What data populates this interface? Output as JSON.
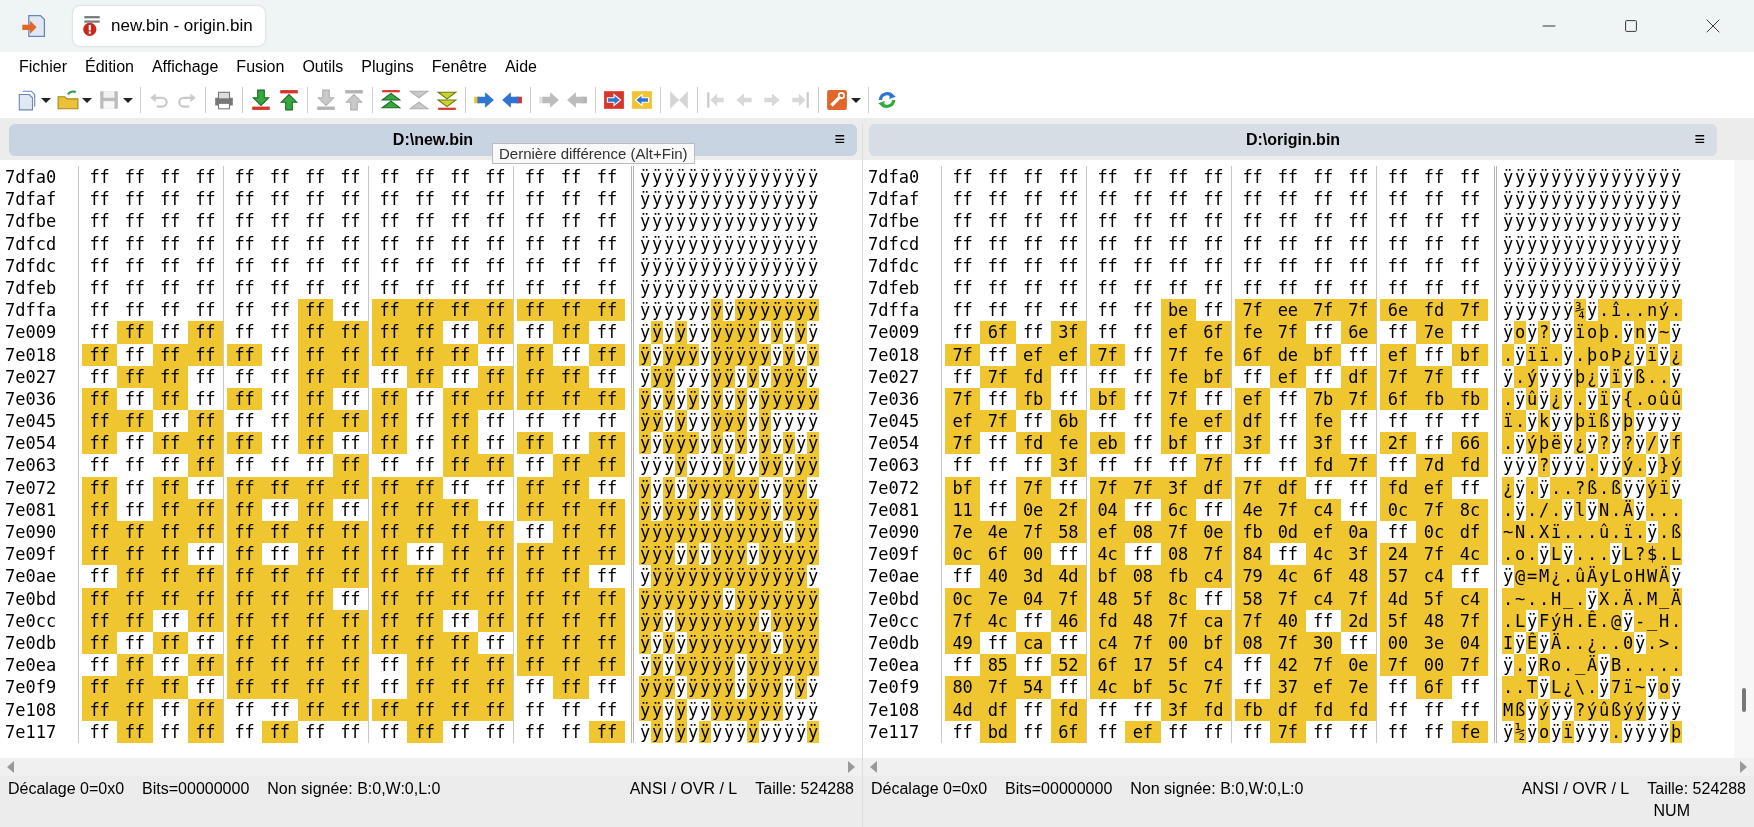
{
  "window": {
    "title": "new.bin - origin.bin"
  },
  "menu": [
    "Fichier",
    "Édition",
    "Affichage",
    "Fusion",
    "Outils",
    "Plugins",
    "Fenêtre",
    "Aide"
  ],
  "toolbar": [
    [
      {
        "disabled": false,
        "dropdown": true
      },
      {
        "disabled": false,
        "dropdown": true
      },
      {
        "disabled": true,
        "dropdown": true
      }
    ],
    [
      {
        "disabled": true,
        "dropdown": false
      },
      {
        "disabled": true,
        "dropdown": false
      }
    ],
    [
      {
        "disabled": false,
        "dropdown": false
      }
    ],
    [
      {
        "disabled": false,
        "dropdown": false
      },
      {
        "disabled": false,
        "dropdown": false
      }
    ],
    [
      {
        "disabled": true,
        "dropdown": false
      },
      {
        "disabled": true,
        "dropdown": false
      }
    ],
    [
      {
        "disabled": false,
        "dropdown": false
      },
      {
        "disabled": true,
        "dropdown": false
      },
      {
        "disabled": false,
        "dropdown": false
      }
    ],
    [
      {
        "disabled": false,
        "dropdown": false
      },
      {
        "disabled": false,
        "dropdown": false
      }
    ],
    [
      {
        "disabled": true,
        "dropdown": false
      },
      {
        "disabled": true,
        "dropdown": false
      }
    ],
    [
      {
        "disabled": false,
        "dropdown": false
      },
      {
        "disabled": false,
        "dropdown": false
      }
    ],
    [
      {
        "disabled": true,
        "dropdown": false
      }
    ],
    [
      {
        "disabled": true,
        "dropdown": false
      },
      {
        "disabled": true,
        "dropdown": false
      },
      {
        "disabled": true,
        "dropdown": false
      },
      {
        "disabled": true,
        "dropdown": false
      }
    ],
    [
      {
        "disabled": false,
        "dropdown": true
      }
    ],
    [
      {
        "disabled": false,
        "dropdown": false
      }
    ]
  ],
  "tooltip": "Dernière différence (Alt+Fin)",
  "panes": [
    {
      "title": "D:\\new.bin",
      "menu_glyph": "≡",
      "active": true,
      "rows": [
        {
          "offset": "7dfa0",
          "bytes": [
            "ff",
            "ff",
            "ff",
            "ff",
            "ff",
            "ff",
            "ff",
            "ff",
            "ff",
            "ff",
            "ff",
            "ff",
            "ff",
            "ff",
            "ff"
          ],
          "ascii": "ÿÿÿÿÿÿÿÿÿÿÿÿÿÿÿ"
        },
        {
          "offset": "7dfaf",
          "bytes": [
            "ff",
            "ff",
            "ff",
            "ff",
            "ff",
            "ff",
            "ff",
            "ff",
            "ff",
            "ff",
            "ff",
            "ff",
            "ff",
            "ff",
            "ff"
          ],
          "ascii": "ÿÿÿÿÿÿÿÿÿÿÿÿÿÿÿ"
        },
        {
          "offset": "7dfbe",
          "bytes": [
            "ff",
            "ff",
            "ff",
            "ff",
            "ff",
            "ff",
            "ff",
            "ff",
            "ff",
            "ff",
            "ff",
            "ff",
            "ff",
            "ff",
            "ff"
          ],
          "ascii": "ÿÿÿÿÿÿÿÿÿÿÿÿÿÿÿ"
        },
        {
          "offset": "7dfcd",
          "bytes": [
            "ff",
            "ff",
            "ff",
            "ff",
            "ff",
            "ff",
            "ff",
            "ff",
            "ff",
            "ff",
            "ff",
            "ff",
            "ff",
            "ff",
            "ff"
          ],
          "ascii": "ÿÿÿÿÿÿÿÿÿÿÿÿÿÿÿ"
        },
        {
          "offset": "7dfdc",
          "bytes": [
            "ff",
            "ff",
            "ff",
            "ff",
            "ff",
            "ff",
            "ff",
            "ff",
            "ff",
            "ff",
            "ff",
            "ff",
            "ff",
            "ff",
            "ff"
          ],
          "ascii": "ÿÿÿÿÿÿÿÿÿÿÿÿÿÿÿ"
        },
        {
          "offset": "7dfeb",
          "bytes": [
            "ff",
            "ff",
            "ff",
            "ff",
            "ff",
            "ff",
            "ff",
            "ff",
            "ff",
            "ff",
            "ff",
            "ff",
            "ff",
            "ff",
            "ff"
          ],
          "ascii": "ÿÿÿÿÿÿÿÿÿÿÿÿÿÿÿ"
        },
        {
          "offset": "7dffa",
          "bytes": [
            "ff",
            "ff",
            "ff",
            "ff",
            "ff",
            "ff",
            "ff",
            "ff",
            "ff",
            "ff",
            "ff",
            "ff",
            "ff",
            "ff",
            "ff"
          ],
          "ascii": "ÿÿÿÿÿÿÿÿÿÿÿÿÿÿÿ"
        },
        {
          "offset": "7e009",
          "bytes": [
            "ff",
            "ff",
            "ff",
            "ff",
            "ff",
            "ff",
            "ff",
            "ff",
            "ff",
            "ff",
            "ff",
            "ff",
            "ff",
            "ff",
            "ff"
          ],
          "ascii": "ÿÿÿÿÿÿÿÿÿÿÿÿÿÿÿ"
        },
        {
          "offset": "7e018",
          "bytes": [
            "ff",
            "ff",
            "ff",
            "ff",
            "ff",
            "ff",
            "ff",
            "ff",
            "ff",
            "ff",
            "ff",
            "ff",
            "ff",
            "ff",
            "ff"
          ],
          "ascii": "ÿÿÿÿÿÿÿÿÿÿÿÿÿÿÿ"
        },
        {
          "offset": "7e027",
          "bytes": [
            "ff",
            "ff",
            "ff",
            "ff",
            "ff",
            "ff",
            "ff",
            "ff",
            "ff",
            "ff",
            "ff",
            "ff",
            "ff",
            "ff",
            "ff"
          ],
          "ascii": "ÿÿÿÿÿÿÿÿÿÿÿÿÿÿÿ"
        },
        {
          "offset": "7e036",
          "bytes": [
            "ff",
            "ff",
            "ff",
            "ff",
            "ff",
            "ff",
            "ff",
            "ff",
            "ff",
            "ff",
            "ff",
            "ff",
            "ff",
            "ff",
            "ff"
          ],
          "ascii": "ÿÿÿÿÿÿÿÿÿÿÿÿÿÿÿ"
        },
        {
          "offset": "7e045",
          "bytes": [
            "ff",
            "ff",
            "ff",
            "ff",
            "ff",
            "ff",
            "ff",
            "ff",
            "ff",
            "ff",
            "ff",
            "ff",
            "ff",
            "ff",
            "ff"
          ],
          "ascii": "ÿÿÿÿÿÿÿÿÿÿÿÿÿÿÿ"
        },
        {
          "offset": "7e054",
          "bytes": [
            "ff",
            "ff",
            "ff",
            "ff",
            "ff",
            "ff",
            "ff",
            "ff",
            "ff",
            "ff",
            "ff",
            "ff",
            "ff",
            "ff",
            "ff"
          ],
          "ascii": "ÿÿÿÿÿÿÿÿÿÿÿÿÿÿÿ"
        },
        {
          "offset": "7e063",
          "bytes": [
            "ff",
            "ff",
            "ff",
            "ff",
            "ff",
            "ff",
            "ff",
            "ff",
            "ff",
            "ff",
            "ff",
            "ff",
            "ff",
            "ff",
            "ff"
          ],
          "ascii": "ÿÿÿÿÿÿÿÿÿÿÿÿÿÿÿ"
        },
        {
          "offset": "7e072",
          "bytes": [
            "ff",
            "ff",
            "ff",
            "ff",
            "ff",
            "ff",
            "ff",
            "ff",
            "ff",
            "ff",
            "ff",
            "ff",
            "ff",
            "ff",
            "ff"
          ],
          "ascii": "ÿÿÿÿÿÿÿÿÿÿÿÿÿÿÿ"
        },
        {
          "offset": "7e081",
          "bytes": [
            "ff",
            "ff",
            "ff",
            "ff",
            "ff",
            "ff",
            "ff",
            "ff",
            "ff",
            "ff",
            "ff",
            "ff",
            "ff",
            "ff",
            "ff"
          ],
          "ascii": "ÿÿÿÿÿÿÿÿÿÿÿÿÿÿÿ"
        },
        {
          "offset": "7e090",
          "bytes": [
            "ff",
            "ff",
            "ff",
            "ff",
            "ff",
            "ff",
            "ff",
            "ff",
            "ff",
            "ff",
            "ff",
            "ff",
            "ff",
            "ff",
            "ff"
          ],
          "ascii": "ÿÿÿÿÿÿÿÿÿÿÿÿÿÿÿ"
        },
        {
          "offset": "7e09f",
          "bytes": [
            "ff",
            "ff",
            "ff",
            "ff",
            "ff",
            "ff",
            "ff",
            "ff",
            "ff",
            "ff",
            "ff",
            "ff",
            "ff",
            "ff",
            "ff"
          ],
          "ascii": "ÿÿÿÿÿÿÿÿÿÿÿÿÿÿÿ"
        },
        {
          "offset": "7e0ae",
          "bytes": [
            "ff",
            "ff",
            "ff",
            "ff",
            "ff",
            "ff",
            "ff",
            "ff",
            "ff",
            "ff",
            "ff",
            "ff",
            "ff",
            "ff",
            "ff"
          ],
          "ascii": "ÿÿÿÿÿÿÿÿÿÿÿÿÿÿÿ"
        },
        {
          "offset": "7e0bd",
          "bytes": [
            "ff",
            "ff",
            "ff",
            "ff",
            "ff",
            "ff",
            "ff",
            "ff",
            "ff",
            "ff",
            "ff",
            "ff",
            "ff",
            "ff",
            "ff"
          ],
          "ascii": "ÿÿÿÿÿÿÿÿÿÿÿÿÿÿÿ"
        },
        {
          "offset": "7e0cc",
          "bytes": [
            "ff",
            "ff",
            "ff",
            "ff",
            "ff",
            "ff",
            "ff",
            "ff",
            "ff",
            "ff",
            "ff",
            "ff",
            "ff",
            "ff",
            "ff"
          ],
          "ascii": "ÿÿÿÿÿÿÿÿÿÿÿÿÿÿÿ"
        },
        {
          "offset": "7e0db",
          "bytes": [
            "ff",
            "ff",
            "ff",
            "ff",
            "ff",
            "ff",
            "ff",
            "ff",
            "ff",
            "ff",
            "ff",
            "ff",
            "ff",
            "ff",
            "ff"
          ],
          "ascii": "ÿÿÿÿÿÿÿÿÿÿÿÿÿÿÿ"
        },
        {
          "offset": "7e0ea",
          "bytes": [
            "ff",
            "ff",
            "ff",
            "ff",
            "ff",
            "ff",
            "ff",
            "ff",
            "ff",
            "ff",
            "ff",
            "ff",
            "ff",
            "ff",
            "ff"
          ],
          "ascii": "ÿÿÿÿÿÿÿÿÿÿÿÿÿÿÿ"
        },
        {
          "offset": "7e0f9",
          "bytes": [
            "ff",
            "ff",
            "ff",
            "ff",
            "ff",
            "ff",
            "ff",
            "ff",
            "ff",
            "ff",
            "ff",
            "ff",
            "ff",
            "ff",
            "ff"
          ],
          "ascii": "ÿÿÿÿÿÿÿÿÿÿÿÿÿÿÿ"
        },
        {
          "offset": "7e108",
          "bytes": [
            "ff",
            "ff",
            "ff",
            "ff",
            "ff",
            "ff",
            "ff",
            "ff",
            "ff",
            "ff",
            "ff",
            "ff",
            "ff",
            "ff",
            "ff"
          ],
          "ascii": "ÿÿÿÿÿÿÿÿÿÿÿÿÿÿÿ"
        },
        {
          "offset": "7e117",
          "bytes": [
            "ff",
            "ff",
            "ff",
            "ff",
            "ff",
            "ff",
            "ff",
            "ff",
            "ff",
            "ff",
            "ff",
            "ff",
            "ff",
            "ff",
            "ff"
          ],
          "ascii": "ÿÿÿÿÿÿÿÿÿÿÿÿÿÿÿ"
        }
      ],
      "status": {
        "offset": "Décalage 0=0x0",
        "bits": "Bits=00000000",
        "unsigned": "Non signée: B:0,W:0,L:0",
        "mode": "ANSI / OVR / L",
        "size": "Taille: 524288"
      }
    },
    {
      "title": "D:\\origin.bin",
      "menu_glyph": "≡",
      "active": false,
      "rows": [
        {
          "offset": "7dfa0",
          "bytes": [
            "ff",
            "ff",
            "ff",
            "ff",
            "ff",
            "ff",
            "ff",
            "ff",
            "ff",
            "ff",
            "ff",
            "ff",
            "ff",
            "ff",
            "ff"
          ],
          "ascii": "ÿÿÿÿÿÿÿÿÿÿÿÿÿÿÿ"
        },
        {
          "offset": "7dfaf",
          "bytes": [
            "ff",
            "ff",
            "ff",
            "ff",
            "ff",
            "ff",
            "ff",
            "ff",
            "ff",
            "ff",
            "ff",
            "ff",
            "ff",
            "ff",
            "ff"
          ],
          "ascii": "ÿÿÿÿÿÿÿÿÿÿÿÿÿÿÿ"
        },
        {
          "offset": "7dfbe",
          "bytes": [
            "ff",
            "ff",
            "ff",
            "ff",
            "ff",
            "ff",
            "ff",
            "ff",
            "ff",
            "ff",
            "ff",
            "ff",
            "ff",
            "ff",
            "ff"
          ],
          "ascii": "ÿÿÿÿÿÿÿÿÿÿÿÿÿÿÿ"
        },
        {
          "offset": "7dfcd",
          "bytes": [
            "ff",
            "ff",
            "ff",
            "ff",
            "ff",
            "ff",
            "ff",
            "ff",
            "ff",
            "ff",
            "ff",
            "ff",
            "ff",
            "ff",
            "ff"
          ],
          "ascii": "ÿÿÿÿÿÿÿÿÿÿÿÿÿÿÿ"
        },
        {
          "offset": "7dfdc",
          "bytes": [
            "ff",
            "ff",
            "ff",
            "ff",
            "ff",
            "ff",
            "ff",
            "ff",
            "ff",
            "ff",
            "ff",
            "ff",
            "ff",
            "ff",
            "ff"
          ],
          "ascii": "ÿÿÿÿÿÿÿÿÿÿÿÿÿÿÿ"
        },
        {
          "offset": "7dfeb",
          "bytes": [
            "ff",
            "ff",
            "ff",
            "ff",
            "ff",
            "ff",
            "ff",
            "ff",
            "ff",
            "ff",
            "ff",
            "ff",
            "ff",
            "ff",
            "ff"
          ],
          "ascii": "ÿÿÿÿÿÿÿÿÿÿÿÿÿÿÿ"
        },
        {
          "offset": "7dffa",
          "bytes": [
            "ff",
            "ff",
            "ff",
            "ff",
            "ff",
            "ff",
            "be",
            "ff",
            "7f",
            "ee",
            "7f",
            "7f",
            "6e",
            "fd",
            "7f"
          ],
          "ascii": "ÿÿÿÿÿÿ¾ÿ.î..ný."
        },
        {
          "offset": "7e009",
          "bytes": [
            "ff",
            "6f",
            "ff",
            "3f",
            "ff",
            "ff",
            "ef",
            "6f",
            "fe",
            "7f",
            "ff",
            "6e",
            "ff",
            "7e",
            "ff"
          ],
          "ascii": "ÿoÿ?ÿÿïoþ.ÿnÿ~ÿ"
        },
        {
          "offset": "7e018",
          "bytes": [
            "7f",
            "ff",
            "ef",
            "ef",
            "7f",
            "ff",
            "7f",
            "fe",
            "6f",
            "de",
            "bf",
            "ff",
            "ef",
            "ff",
            "bf"
          ],
          "ascii": ".ÿïï.ÿ.þoÞ¿ÿïÿ¿"
        },
        {
          "offset": "7e027",
          "bytes": [
            "ff",
            "7f",
            "fd",
            "ff",
            "ff",
            "ff",
            "fe",
            "bf",
            "ff",
            "ef",
            "ff",
            "df",
            "7f",
            "7f",
            "ff"
          ],
          "ascii": "ÿ.ýÿÿÿþ¿ÿïÿß..ÿ"
        },
        {
          "offset": "7e036",
          "bytes": [
            "7f",
            "ff",
            "fb",
            "ff",
            "bf",
            "ff",
            "7f",
            "ff",
            "ef",
            "ff",
            "7b",
            "7f",
            "6f",
            "fb",
            "fb"
          ],
          "ascii": ".ÿûÿ¿ÿ.ÿïÿ{.oûû"
        },
        {
          "offset": "7e045",
          "bytes": [
            "ef",
            "7f",
            "ff",
            "6b",
            "ff",
            "ff",
            "fe",
            "ef",
            "df",
            "ff",
            "fe",
            "ff",
            "ff",
            "ff",
            "ff"
          ],
          "ascii": "ï.ÿkÿÿþïßÿþÿÿÿÿ"
        },
        {
          "offset": "7e054",
          "bytes": [
            "7f",
            "ff",
            "fd",
            "fe",
            "eb",
            "ff",
            "bf",
            "ff",
            "3f",
            "ff",
            "3f",
            "ff",
            "2f",
            "ff",
            "66"
          ],
          "ascii": ".ÿýþëÿ¿ÿ?ÿ?ÿ/ÿf"
        },
        {
          "offset": "7e063",
          "bytes": [
            "ff",
            "ff",
            "ff",
            "3f",
            "ff",
            "ff",
            "ff",
            "7f",
            "ff",
            "ff",
            "fd",
            "7f",
            "ff",
            "7d",
            "fd"
          ],
          "ascii": "ÿÿÿ?ÿÿÿ.ÿÿý.ÿ}ý"
        },
        {
          "offset": "7e072",
          "bytes": [
            "bf",
            "ff",
            "7f",
            "ff",
            "7f",
            "7f",
            "3f",
            "df",
            "7f",
            "df",
            "ff",
            "ff",
            "fd",
            "ef",
            "ff"
          ],
          "ascii": "¿ÿ.ÿ..?ß.ßÿÿýïÿ"
        },
        {
          "offset": "7e081",
          "bytes": [
            "11",
            "ff",
            "0e",
            "2f",
            "04",
            "ff",
            "6c",
            "ff",
            "4e",
            "7f",
            "c4",
            "ff",
            "0c",
            "7f",
            "8c"
          ],
          "ascii": ".ÿ./.ÿlÿN.Äÿ..."
        },
        {
          "offset": "7e090",
          "bytes": [
            "7e",
            "4e",
            "7f",
            "58",
            "ef",
            "08",
            "7f",
            "0e",
            "fb",
            "0d",
            "ef",
            "0a",
            "ff",
            "0c",
            "df"
          ],
          "ascii": "~N.Xï...û.ï.ÿ.ß"
        },
        {
          "offset": "7e09f",
          "bytes": [
            "0c",
            "6f",
            "00",
            "ff",
            "4c",
            "ff",
            "08",
            "7f",
            "84",
            "ff",
            "4c",
            "3f",
            "24",
            "7f",
            "4c"
          ],
          "ascii": ".o.ÿLÿ...ÿL?$.L"
        },
        {
          "offset": "7e0ae",
          "bytes": [
            "ff",
            "40",
            "3d",
            "4d",
            "bf",
            "08",
            "fb",
            "c4",
            "79",
            "4c",
            "6f",
            "48",
            "57",
            "c4",
            "ff"
          ],
          "ascii": "ÿ@=M¿.ûÄyLoHWÄÿ"
        },
        {
          "offset": "7e0bd",
          "bytes": [
            "0c",
            "7e",
            "04",
            "7f",
            "48",
            "5f",
            "8c",
            "ff",
            "58",
            "7f",
            "c4",
            "7f",
            "4d",
            "5f",
            "c4"
          ],
          "ascii": ".~..H_.ÿX.Ä.M_Ä"
        },
        {
          "offset": "7e0cc",
          "bytes": [
            "7f",
            "4c",
            "ff",
            "46",
            "fd",
            "48",
            "7f",
            "ca",
            "7f",
            "40",
            "ff",
            "2d",
            "5f",
            "48",
            "7f"
          ],
          "ascii": ".LÿFýH.Ê.@ÿ-_H."
        },
        {
          "offset": "7e0db",
          "bytes": [
            "49",
            "ff",
            "ca",
            "ff",
            "c4",
            "7f",
            "00",
            "bf",
            "08",
            "7f",
            "30",
            "ff",
            "00",
            "3e",
            "04"
          ],
          "ascii": "IÿÊÿÄ..¿..0ÿ.>."
        },
        {
          "offset": "7e0ea",
          "bytes": [
            "ff",
            "85",
            "ff",
            "52",
            "6f",
            "17",
            "5f",
            "c4",
            "ff",
            "42",
            "7f",
            "0e",
            "7f",
            "00",
            "7f"
          ],
          "ascii": "ÿ.ÿRo._ÄÿB....."
        },
        {
          "offset": "7e0f9",
          "bytes": [
            "80",
            "7f",
            "54",
            "ff",
            "4c",
            "bf",
            "5c",
            "7f",
            "ff",
            "37",
            "ef",
            "7e",
            "ff",
            "6f",
            "ff"
          ],
          "ascii": "..TÿL¿\\.ÿ7ï~ÿoÿ"
        },
        {
          "offset": "7e108",
          "bytes": [
            "4d",
            "df",
            "ff",
            "fd",
            "ff",
            "ff",
            "3f",
            "fd",
            "fb",
            "df",
            "fd",
            "fd",
            "ff",
            "ff",
            "ff"
          ],
          "ascii": "Mßÿýÿÿ?ýûßýýÿÿÿ"
        },
        {
          "offset": "7e117",
          "bytes": [
            "ff",
            "bd",
            "ff",
            "6f",
            "ff",
            "ef",
            "ff",
            "ff",
            "ff",
            "7f",
            "ff",
            "ff",
            "ff",
            "ff",
            "fe"
          ],
          "ascii": "ÿ½ÿoÿïÿÿÿ.ÿÿÿÿþ"
        }
      ],
      "status": {
        "offset": "Décalage 0=0x0",
        "bits": "Bits=00000000",
        "unsigned": "Non signée: B:0,W:0,L:0",
        "mode": "ANSI / OVR / L",
        "size": "Taille: 524288",
        "indicator": "NUM"
      }
    }
  ]
}
